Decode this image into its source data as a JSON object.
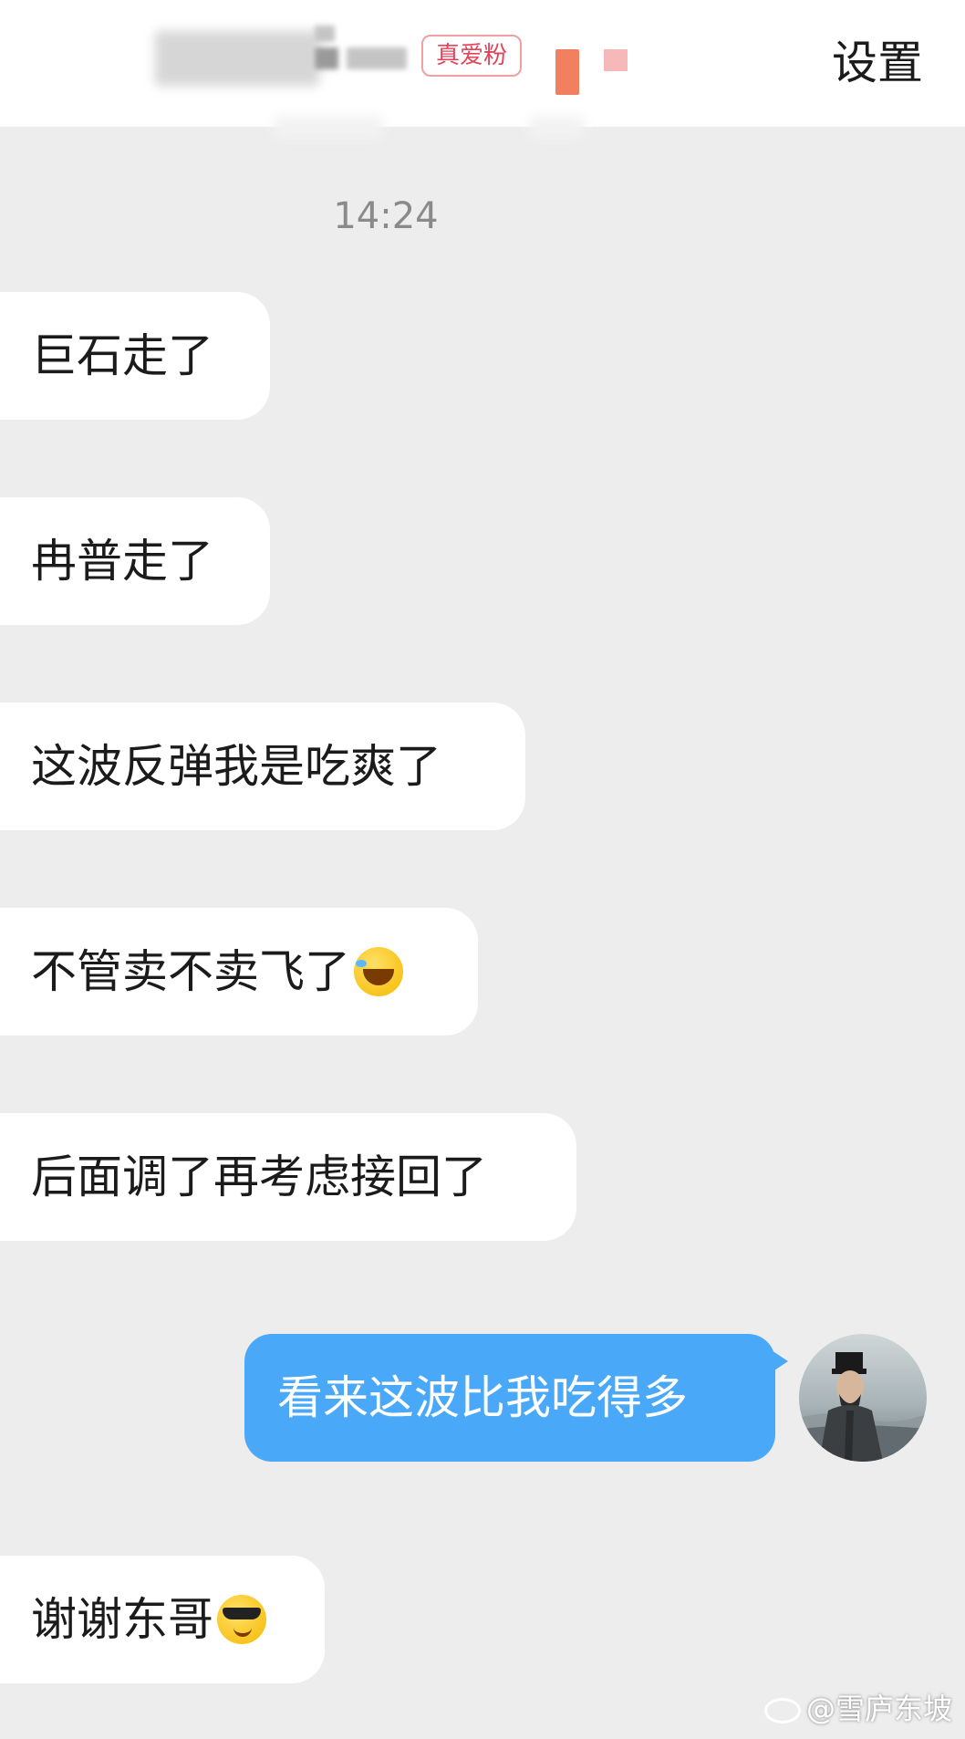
{
  "header": {
    "badge": "真爱粉",
    "settings_label": "设置",
    "badge_color": "#e0455a"
  },
  "chat": {
    "timestamp": "14:24",
    "messages": [
      {
        "sender": "other",
        "text": "巨石走了"
      },
      {
        "sender": "other",
        "text": "冉普走了"
      },
      {
        "sender": "other",
        "text": "这波反弹我是吃爽了"
      },
      {
        "sender": "other",
        "text": "不管卖不卖飞了",
        "emoji": "laughing-crying-emoji"
      },
      {
        "sender": "other",
        "text": "后面调了再考虑接回了"
      },
      {
        "sender": "me",
        "text": "看来这波比我吃得多"
      },
      {
        "sender": "other",
        "text": "谢谢东哥",
        "emoji": "sunglasses-emoji"
      }
    ],
    "my_bubble_color": "#4aa8f8"
  },
  "watermark": {
    "text": "@雪庐东坡",
    "icon": "weibo-icon"
  }
}
